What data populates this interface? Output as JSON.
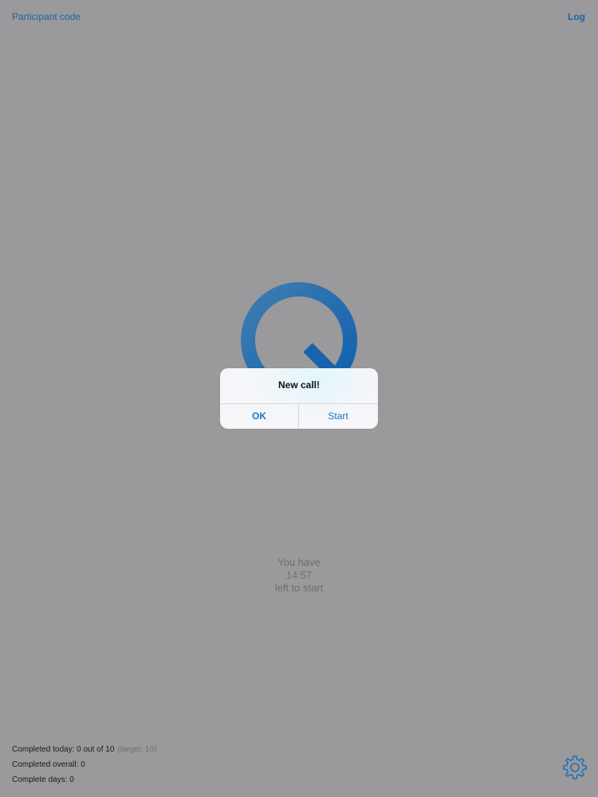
{
  "header": {
    "participant_code_label": "Participant code",
    "log_label": "Log"
  },
  "logo": {
    "icon": "q-logo-icon",
    "color": "#1e6fb8"
  },
  "countdown": {
    "line1": "You have",
    "time": "14:57",
    "line3": "left to start"
  },
  "stats": {
    "completed_today": "Completed today: 0 out of 10",
    "target": "(target: 10)",
    "completed_overall": "Completed overall: 0",
    "complete_days": "Complete days: 0"
  },
  "settings": {
    "icon": "gear-icon"
  },
  "alert": {
    "title": "New call!",
    "ok_label": "OK",
    "start_label": "Start"
  },
  "colors": {
    "accent": "#1e73be",
    "background": "#9a999b"
  }
}
